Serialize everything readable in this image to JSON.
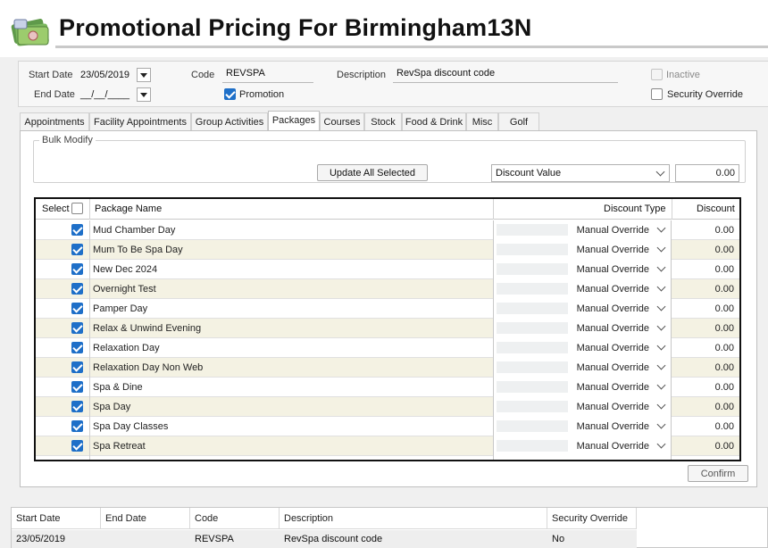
{
  "header": {
    "title": "Promotional Pricing For Birmingham13N",
    "icon": "money-stack-icon"
  },
  "filters": {
    "start_date_label": "Start Date",
    "start_date_value": "23/05/2019",
    "end_date_label": "End Date",
    "end_date_value": "__/__/____",
    "code_label": "Code",
    "code_value": "REVSPA",
    "promotion_label": "Promotion",
    "promotion_checked": true,
    "description_label": "Description",
    "description_value": "RevSpa discount code",
    "inactive_label": "Inactive",
    "security_override_label": "Security Override"
  },
  "tabs": [
    {
      "label": "Appointments"
    },
    {
      "label": "Facility Appointments"
    },
    {
      "label": "Group Activities"
    },
    {
      "label": "Packages",
      "active": true
    },
    {
      "label": "Courses"
    },
    {
      "label": "Stock"
    },
    {
      "label": "Food & Drink"
    },
    {
      "label": "Misc"
    },
    {
      "label": "Golf"
    }
  ],
  "bulk": {
    "title": "Bulk Modify",
    "update_button": "Update All Selected",
    "discount_select": "Discount Value",
    "discount_value": "0.00"
  },
  "grid": {
    "columns": {
      "select": "Select",
      "name": "Package Name",
      "type": "Discount Type",
      "discount": "Discount"
    },
    "rows": [
      {
        "name": "Mud Chamber Day",
        "type": "Manual Override",
        "discount": "0.00"
      },
      {
        "name": "Mum To Be Spa Day",
        "type": "Manual Override",
        "discount": "0.00"
      },
      {
        "name": "New Dec 2024",
        "type": "Manual Override",
        "discount": "0.00"
      },
      {
        "name": "Overnight Test",
        "type": "Manual Override",
        "discount": "0.00"
      },
      {
        "name": "Pamper Day",
        "type": "Manual Override",
        "discount": "0.00"
      },
      {
        "name": "Relax & Unwind Evening",
        "type": "Manual Override",
        "discount": "0.00"
      },
      {
        "name": "Relaxation Day",
        "type": "Manual Override",
        "discount": "0.00"
      },
      {
        "name": "Relaxation Day Non Web",
        "type": "Manual Override",
        "discount": "0.00"
      },
      {
        "name": "Spa & Dine",
        "type": "Manual Override",
        "discount": "0.00"
      },
      {
        "name": "Spa Day",
        "type": "Manual Override",
        "discount": "0.00"
      },
      {
        "name": "Spa Day Classes",
        "type": "Manual Override",
        "discount": "0.00"
      },
      {
        "name": "Spa Retreat",
        "type": "Manual Override",
        "discount": "0.00"
      }
    ]
  },
  "confirm_button": "Confirm",
  "summary": {
    "headers": [
      "Start Date",
      "End Date",
      "Code",
      "Description",
      "Security Override"
    ],
    "row": [
      "23/05/2019",
      "",
      "REVSPA",
      "RevSpa discount code",
      "No"
    ]
  }
}
